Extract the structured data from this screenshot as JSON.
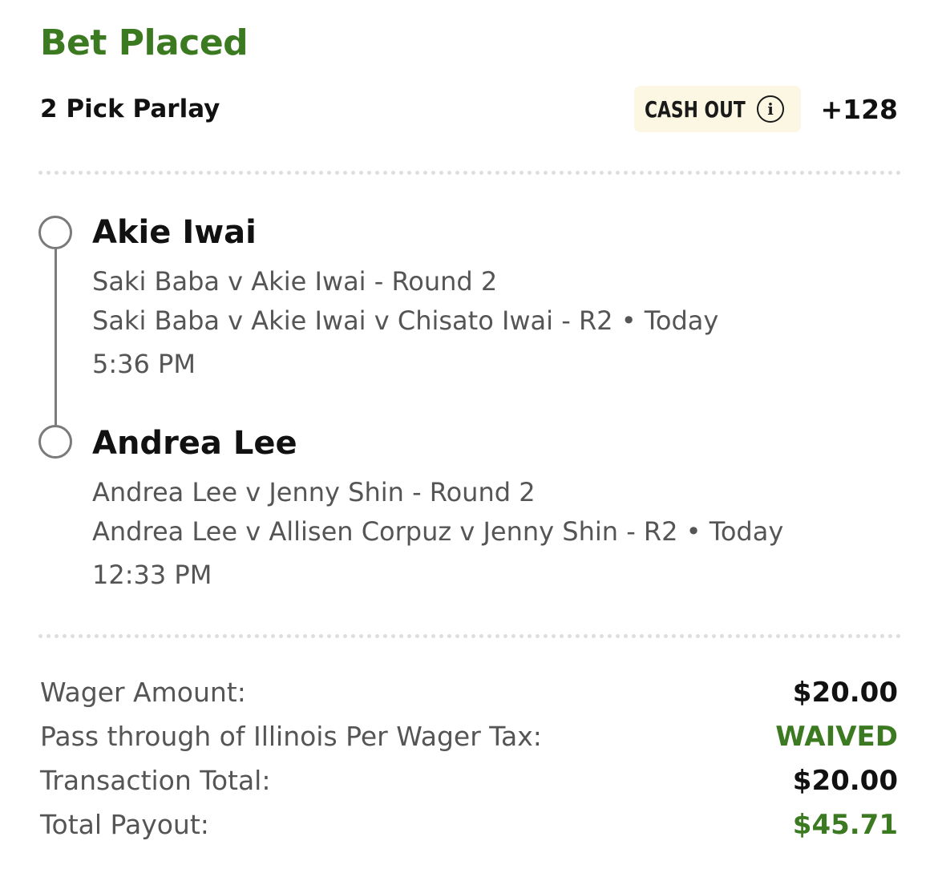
{
  "header": {
    "title": "Bet Placed",
    "bet_type": "2 Pick Parlay",
    "cash_out_label": "CASH OUT",
    "cash_out_icon": "info-icon",
    "odds": "+128"
  },
  "legs": [
    {
      "selection": "Akie Iwai",
      "market": "Saki Baba v Akie Iwai - Round 2",
      "event_line": "Saki Baba v Akie Iwai v Chisato Iwai - R2 • Today",
      "time": "5:36 PM"
    },
    {
      "selection": "Andrea Lee",
      "market": "Andrea Lee v Jenny Shin - Round 2",
      "event_line": "Andrea Lee v Allisen Corpuz v Jenny Shin - R2 • Today",
      "time": "12:33 PM"
    }
  ],
  "summary": [
    {
      "label": "Wager Amount:",
      "value": "$20.00"
    },
    {
      "label": "Pass through of Illinois Per Wager Tax:",
      "value": "WAIVED"
    },
    {
      "label": "Transaction Total:",
      "value": "$20.00"
    },
    {
      "label": "Total Payout:",
      "value": "$45.71"
    }
  ],
  "colors": {
    "accent_green": "#3c7a22",
    "cash_out_bg": "#fbf7e2",
    "muted_text": "#555555"
  }
}
